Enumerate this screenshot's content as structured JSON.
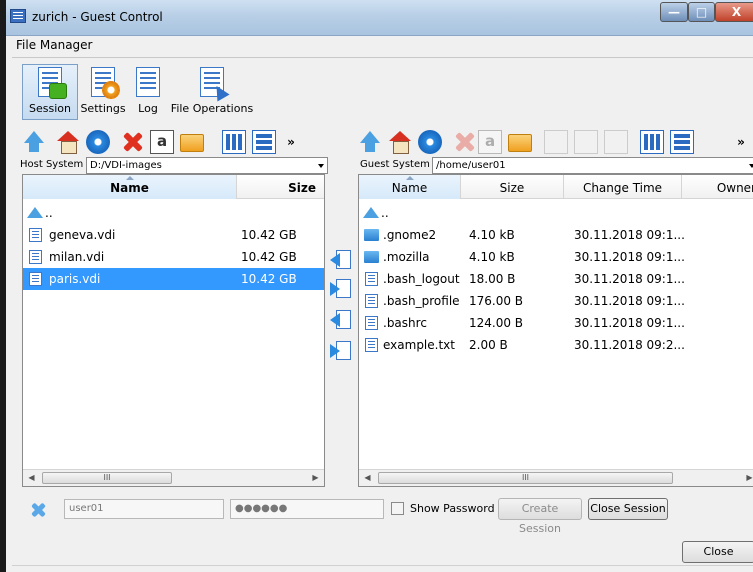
{
  "window": {
    "title": "zurich - Guest Control"
  },
  "section_title": "File Manager",
  "ribbon": {
    "session": "Session",
    "settings": "Settings",
    "log": "Log",
    "file_ops": "File Operations"
  },
  "toolbar": {
    "rename_glyph": "a",
    "overflow": "»"
  },
  "host": {
    "label": "Host System",
    "path": "D:/VDI-images",
    "columns": {
      "name": "Name",
      "size": "Size"
    },
    "parent": "..",
    "files": [
      {
        "name": "geneva.vdi",
        "size": "10.42 GB"
      },
      {
        "name": "milan.vdi",
        "size": "10.42 GB"
      },
      {
        "name": "paris.vdi",
        "size": "10.42 GB"
      }
    ],
    "scroll_thumb": "III"
  },
  "guest": {
    "label": "Guest System",
    "path": "/home/user01",
    "columns": {
      "name": "Name",
      "size": "Size",
      "time": "Change Time",
      "owner": "Owner"
    },
    "parent": "..",
    "files": [
      {
        "name": ".gnome2",
        "size": "4.10 kB",
        "time": "30.11.2018 09:1...",
        "type": "dir"
      },
      {
        "name": ".mozilla",
        "size": "4.10 kB",
        "time": "30.11.2018 09:1...",
        "type": "dir"
      },
      {
        "name": ".bash_logout",
        "size": "18.00 B",
        "time": "30.11.2018 09:1...",
        "type": "file"
      },
      {
        "name": ".bash_profile",
        "size": "176.00 B",
        "time": "30.11.2018 09:1...",
        "type": "file"
      },
      {
        "name": ".bashrc",
        "size": "124.00 B",
        "time": "30.11.2018 09:1...",
        "type": "file"
      },
      {
        "name": "example.txt",
        "size": "2.00 B",
        "time": "30.11.2018 09:2...",
        "type": "file"
      }
    ],
    "scroll_thumb": "III"
  },
  "session": {
    "username": "user01",
    "password_mask": "●●●●●●",
    "show_password": "Show Password",
    "create": "Create Session",
    "close": "Close Session"
  },
  "close_button": "Close",
  "colors": {
    "selection": "#3399ff",
    "accent": "#2a8ae0"
  }
}
